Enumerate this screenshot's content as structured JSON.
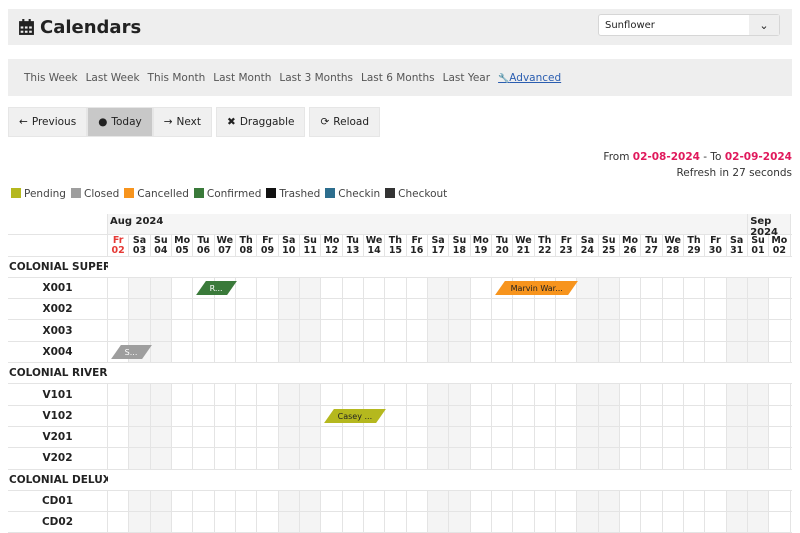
{
  "header": {
    "title": "Calendars",
    "property_select": "Sunflower"
  },
  "ranges": [
    "This Week",
    "Last Week",
    "This Month",
    "Last Month",
    "Last 3 Months",
    "Last 6 Months",
    "Last Year"
  ],
  "advanced_label": "Advanced",
  "buttons": {
    "previous": "Previous",
    "today": "Today",
    "next": "Next",
    "draggable": "Draggable",
    "reload": "Reload"
  },
  "range_info": {
    "from_label": "From",
    "from": "02-08-2024",
    "to_label": "- To",
    "to": "02-09-2024",
    "refresh": "Refresh in 27 seconds"
  },
  "legend": [
    {
      "label": "Pending",
      "color": "#b5b81e"
    },
    {
      "label": "Closed",
      "color": "#9e9e9e"
    },
    {
      "label": "Cancelled",
      "color": "#f7941d"
    },
    {
      "label": "Confirmed",
      "color": "#3a7a3a"
    },
    {
      "label": "Trashed",
      "color": "#111111"
    },
    {
      "label": "Checkin",
      "color": "#2d6e8e"
    },
    {
      "label": "Checkout",
      "color": "#333333"
    }
  ],
  "months": [
    {
      "label": "Aug 2024",
      "days": 30
    },
    {
      "label": "Sep 2024",
      "days": 2
    }
  ],
  "days": [
    [
      "Fr",
      "02"
    ],
    [
      "Sa",
      "03"
    ],
    [
      "Su",
      "04"
    ],
    [
      "Mo",
      "05"
    ],
    [
      "Tu",
      "06"
    ],
    [
      "We",
      "07"
    ],
    [
      "Th",
      "08"
    ],
    [
      "Fr",
      "09"
    ],
    [
      "Sa",
      "10"
    ],
    [
      "Su",
      "11"
    ],
    [
      "Mo",
      "12"
    ],
    [
      "Tu",
      "13"
    ],
    [
      "We",
      "14"
    ],
    [
      "Th",
      "15"
    ],
    [
      "Fr",
      "16"
    ],
    [
      "Sa",
      "17"
    ],
    [
      "Su",
      "18"
    ],
    [
      "Mo",
      "19"
    ],
    [
      "Tu",
      "20"
    ],
    [
      "We",
      "21"
    ],
    [
      "Th",
      "22"
    ],
    [
      "Fr",
      "23"
    ],
    [
      "Sa",
      "24"
    ],
    [
      "Su",
      "25"
    ],
    [
      "Mo",
      "26"
    ],
    [
      "Tu",
      "27"
    ],
    [
      "We",
      "28"
    ],
    [
      "Th",
      "29"
    ],
    [
      "Fr",
      "30"
    ],
    [
      "Sa",
      "31"
    ],
    [
      "Su",
      "01"
    ],
    [
      "Mo",
      "02"
    ]
  ],
  "rows": [
    {
      "label": "COLONIAL SUPER...",
      "group": true
    },
    {
      "label": "X001"
    },
    {
      "label": "X002"
    },
    {
      "label": "X003"
    },
    {
      "label": "X004"
    },
    {
      "label": "COLONIAL RIVER ...",
      "group": true
    },
    {
      "label": "V101"
    },
    {
      "label": "V102"
    },
    {
      "label": "V201"
    },
    {
      "label": "V202"
    },
    {
      "label": "COLONIAL DELUXE",
      "group": true
    },
    {
      "label": "CD01"
    },
    {
      "label": "CD02"
    }
  ],
  "bookings": [
    {
      "room": "X001",
      "label": "R...",
      "status": "Confirmed",
      "start": "06",
      "nights": 2
    },
    {
      "room": "X001",
      "label": "Marvin War...",
      "status": "Cancelled",
      "start": "20",
      "nights": 4
    },
    {
      "room": "X004",
      "label": "S...",
      "status": "Closed",
      "start": "02",
      "nights": 2
    },
    {
      "room": "V102",
      "label": "Casey ...",
      "status": "Pending",
      "start": "12",
      "nights": 3
    }
  ]
}
